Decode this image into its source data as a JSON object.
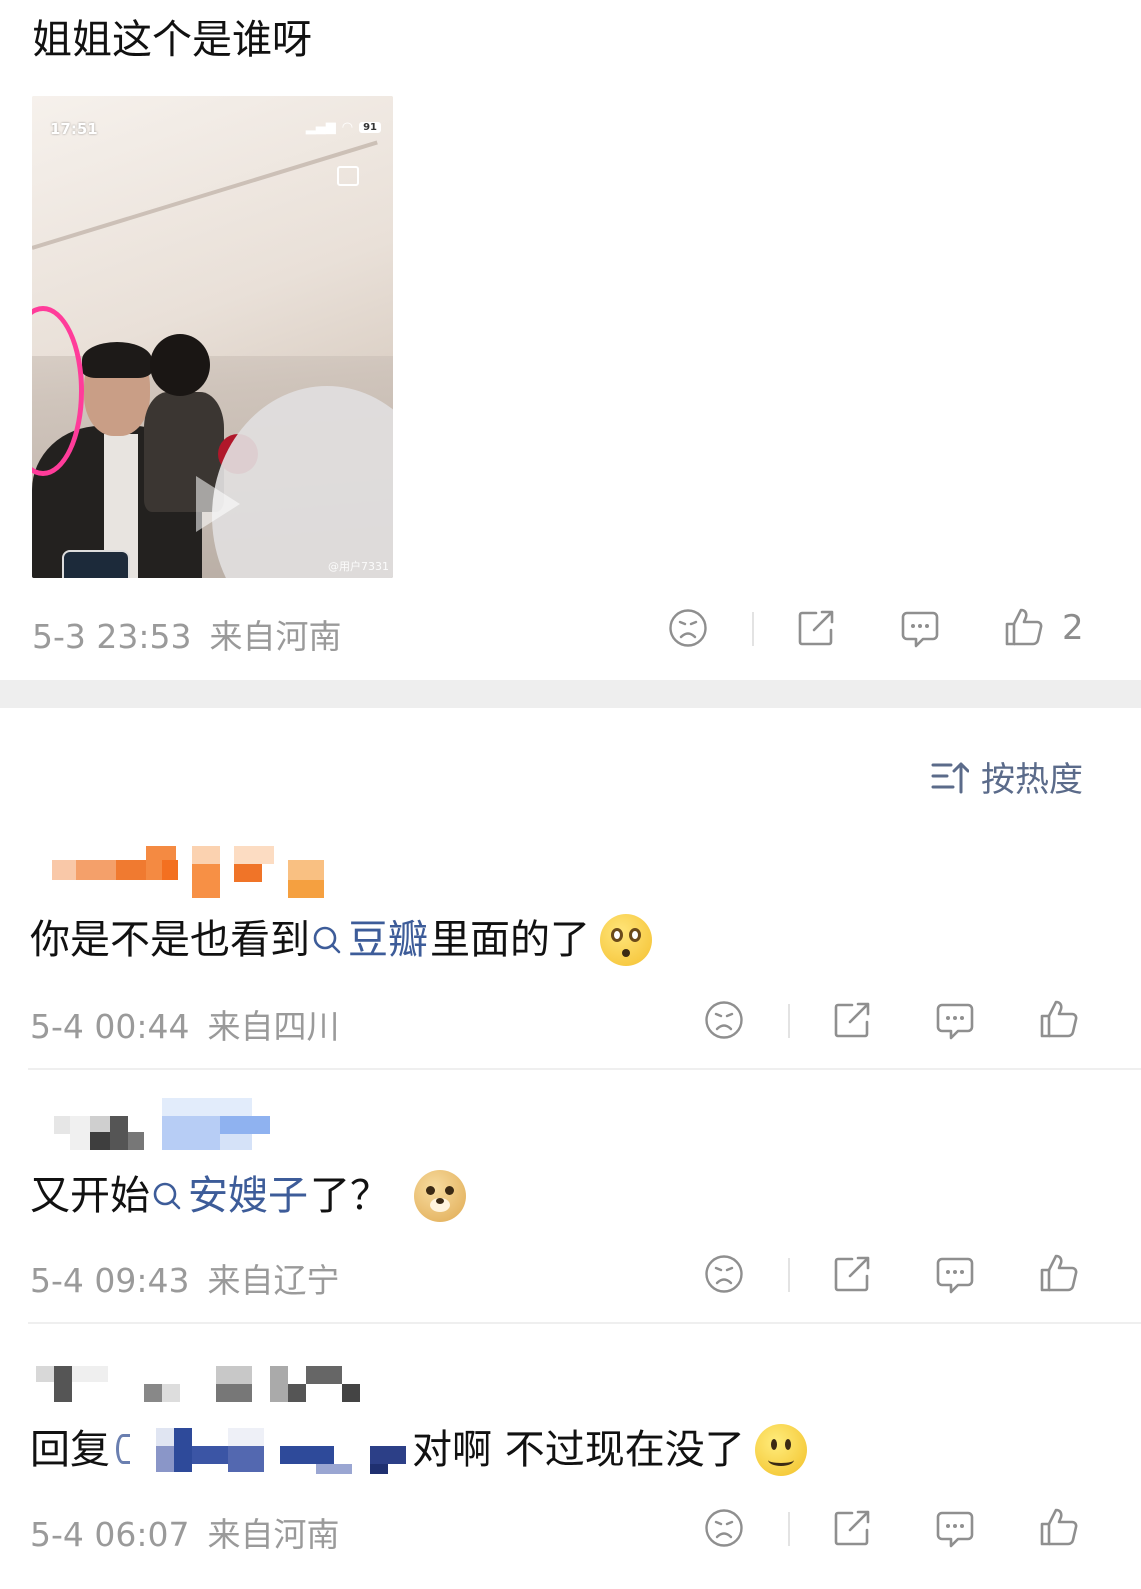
{
  "post": {
    "text": "姐姐这个是谁呀",
    "photo": {
      "status_time": "17:51",
      "battery": "91",
      "watermark": "@用户7331"
    },
    "date": "5-3 23:53",
    "location": "来自河南",
    "like_count": "2"
  },
  "sort": {
    "label": "按热度",
    "icon": "sort-icon"
  },
  "comments": [
    {
      "text_before": "你是不是也看到",
      "topic": "豆瓣",
      "text_after": "里面的了",
      "emoji": "flushed-emoji",
      "date": "5-4 00:44",
      "location": "来自四川"
    },
    {
      "text_before": "又开始",
      "topic": "安嫂子",
      "text_after": "了？",
      "emoji": "doge-emoji",
      "date": "5-4 09:43",
      "location": "来自辽宁"
    },
    {
      "reply_prefix": "回复",
      "text_after": "对啊 不过现在没了",
      "emoji": "smile-emoji",
      "date": "5-4 06:07",
      "location": "来自河南"
    }
  ],
  "icons": [
    "sad-face-icon",
    "share-icon",
    "comment-icon",
    "like-icon",
    "search-topic-icon"
  ],
  "colors": {
    "topic": "#3d5c99",
    "meta": "#9a9a9a",
    "separator": "#eeeeee"
  }
}
